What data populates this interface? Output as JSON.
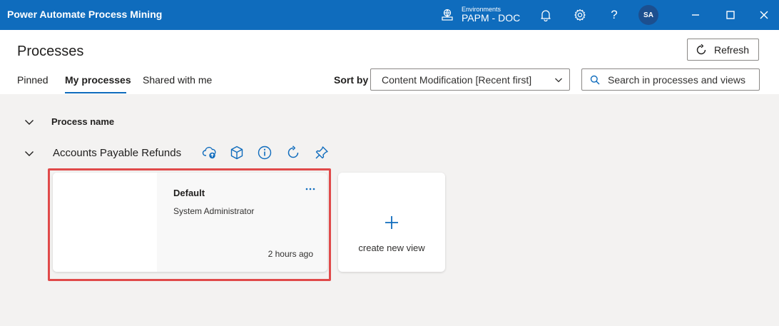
{
  "app": {
    "title": "Power Automate Process Mining"
  },
  "environment": {
    "label": "Environments",
    "name": "PAPM - DOC"
  },
  "user": {
    "initials": "SA"
  },
  "page": {
    "title": "Processes",
    "refresh_label": "Refresh"
  },
  "tabs": [
    {
      "label": "Pinned",
      "active": false
    },
    {
      "label": "My processes",
      "active": true
    },
    {
      "label": "Shared with me",
      "active": false
    }
  ],
  "sort": {
    "label": "Sort by",
    "value": "Content Modification [Recent first]"
  },
  "search": {
    "placeholder": "Search in processes and views"
  },
  "list": {
    "column_header": "Process name",
    "groups": [
      {
        "name": "Accounts Payable Refunds",
        "actions": [
          "cloud-upload-icon",
          "cube-icon",
          "info-icon",
          "refresh-icon",
          "pin-icon"
        ],
        "views": [
          {
            "title": "Default",
            "owner": "System Administrator",
            "modified": "2 hours ago"
          }
        ],
        "new_view_label": "create new view"
      }
    ]
  },
  "colors": {
    "accent": "#0f6cbd",
    "highlight": "#e04a4a",
    "background": "#f3f2f1"
  }
}
